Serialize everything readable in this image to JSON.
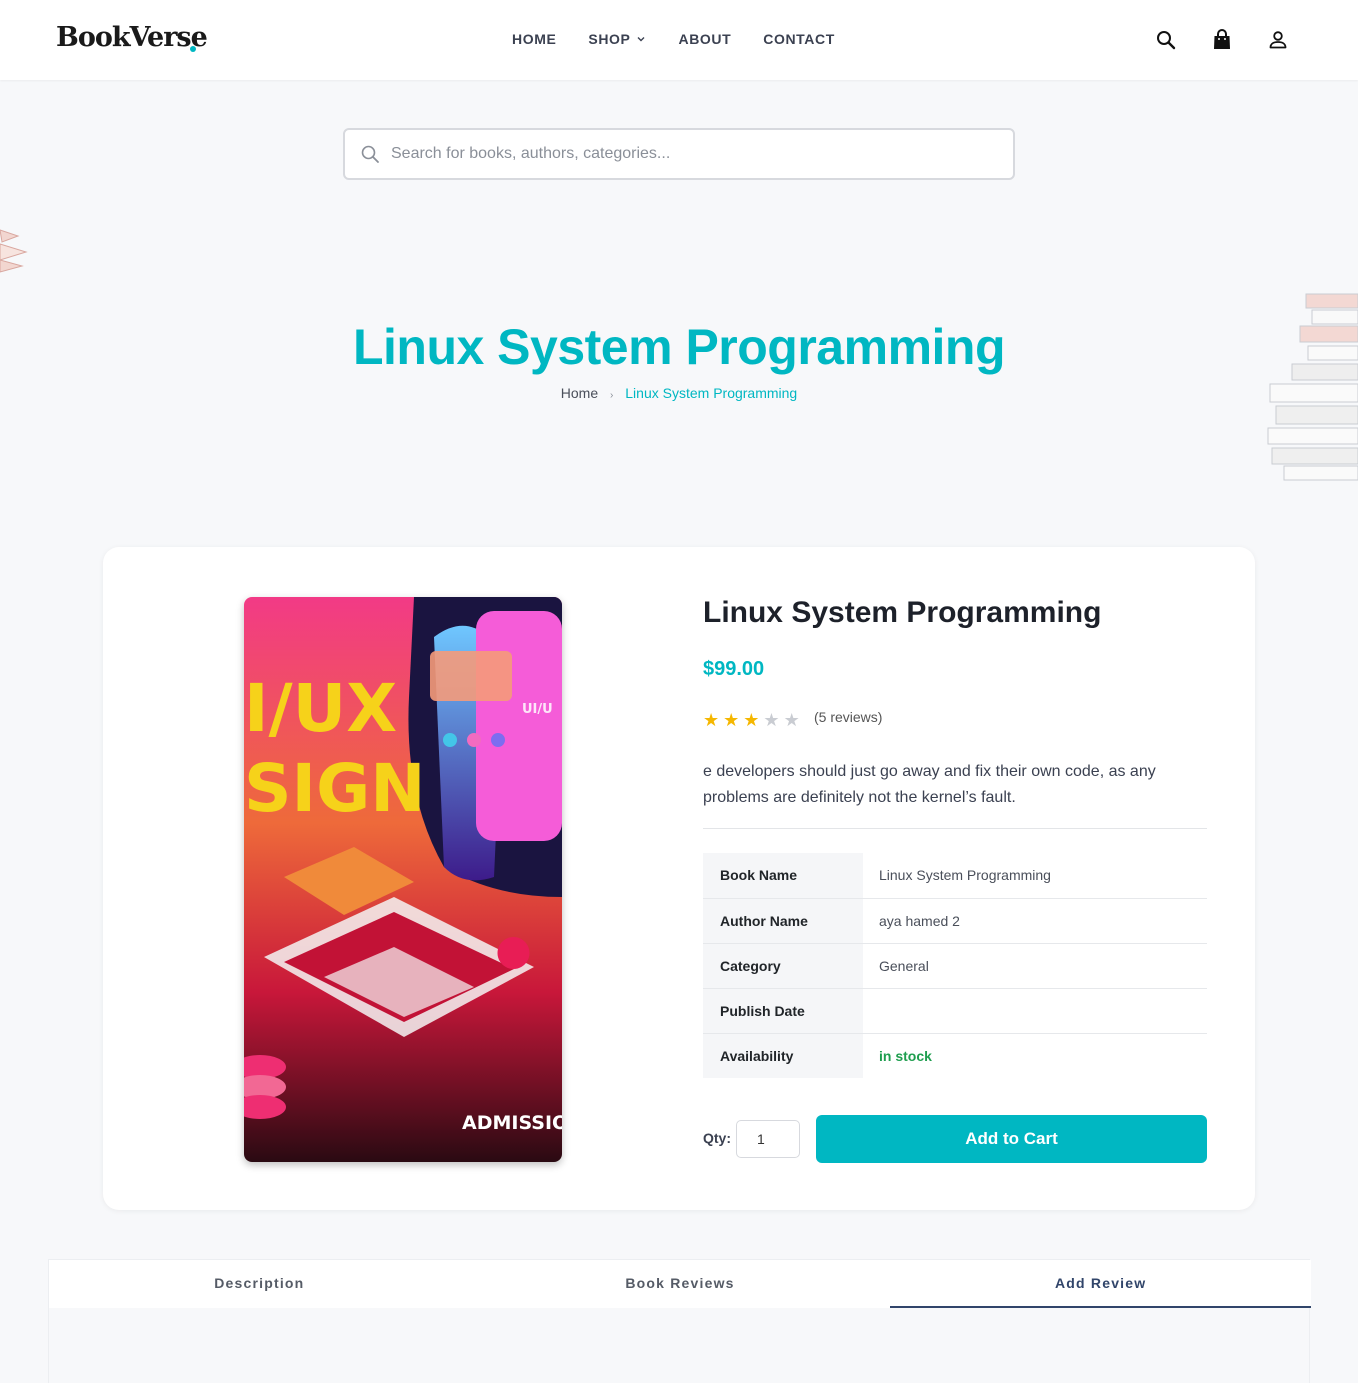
{
  "header": {
    "logo": "BookVerse",
    "nav": [
      {
        "label": "HOME"
      },
      {
        "label": "SHOP",
        "has_dropdown": true
      },
      {
        "label": "ABOUT"
      },
      {
        "label": "CONTACT"
      }
    ],
    "icons": [
      "search-icon",
      "shopping-bag-icon",
      "user-icon"
    ]
  },
  "search": {
    "placeholder": "Search for books, authors, categories..."
  },
  "page": {
    "title": "Linux System Programming",
    "breadcrumb": {
      "home": "Home",
      "separator": "›",
      "current": "Linux System Programming"
    }
  },
  "product": {
    "name": "Linux System Programming",
    "price": "$99.00",
    "rating": 3,
    "rating_max": 5,
    "reviews_label": "(5 reviews)",
    "excerpt": "e developers should just go away and fix their own code, as any problems are definitely not the kernel’s fault.",
    "cover": {
      "text_line1": "I/UX",
      "text_line2": "SIGN",
      "text_small": "UI/U",
      "text_bottom": "ADMISSIO"
    },
    "specs": [
      {
        "key": "Book Name",
        "value": "Linux System Programming"
      },
      {
        "key": "Author Name",
        "value": "aya hamed 2"
      },
      {
        "key": "Category",
        "value": "General"
      },
      {
        "key": "Publish Date",
        "value": ""
      },
      {
        "key": "Availability",
        "value": "in stock"
      }
    ],
    "qty_label": "Qty:",
    "qty_value": "1",
    "add_to_cart": "Add to Cart"
  },
  "tabs": [
    {
      "label": "Description",
      "active": false
    },
    {
      "label": "Book Reviews",
      "active": false
    },
    {
      "label": "Add Review",
      "active": true
    }
  ],
  "colors": {
    "accent": "#00b7c2",
    "star_filled": "#f5b700",
    "star_empty": "#c9ccd2",
    "in_stock": "#1f9e4f",
    "tab_active": "#31456a"
  }
}
